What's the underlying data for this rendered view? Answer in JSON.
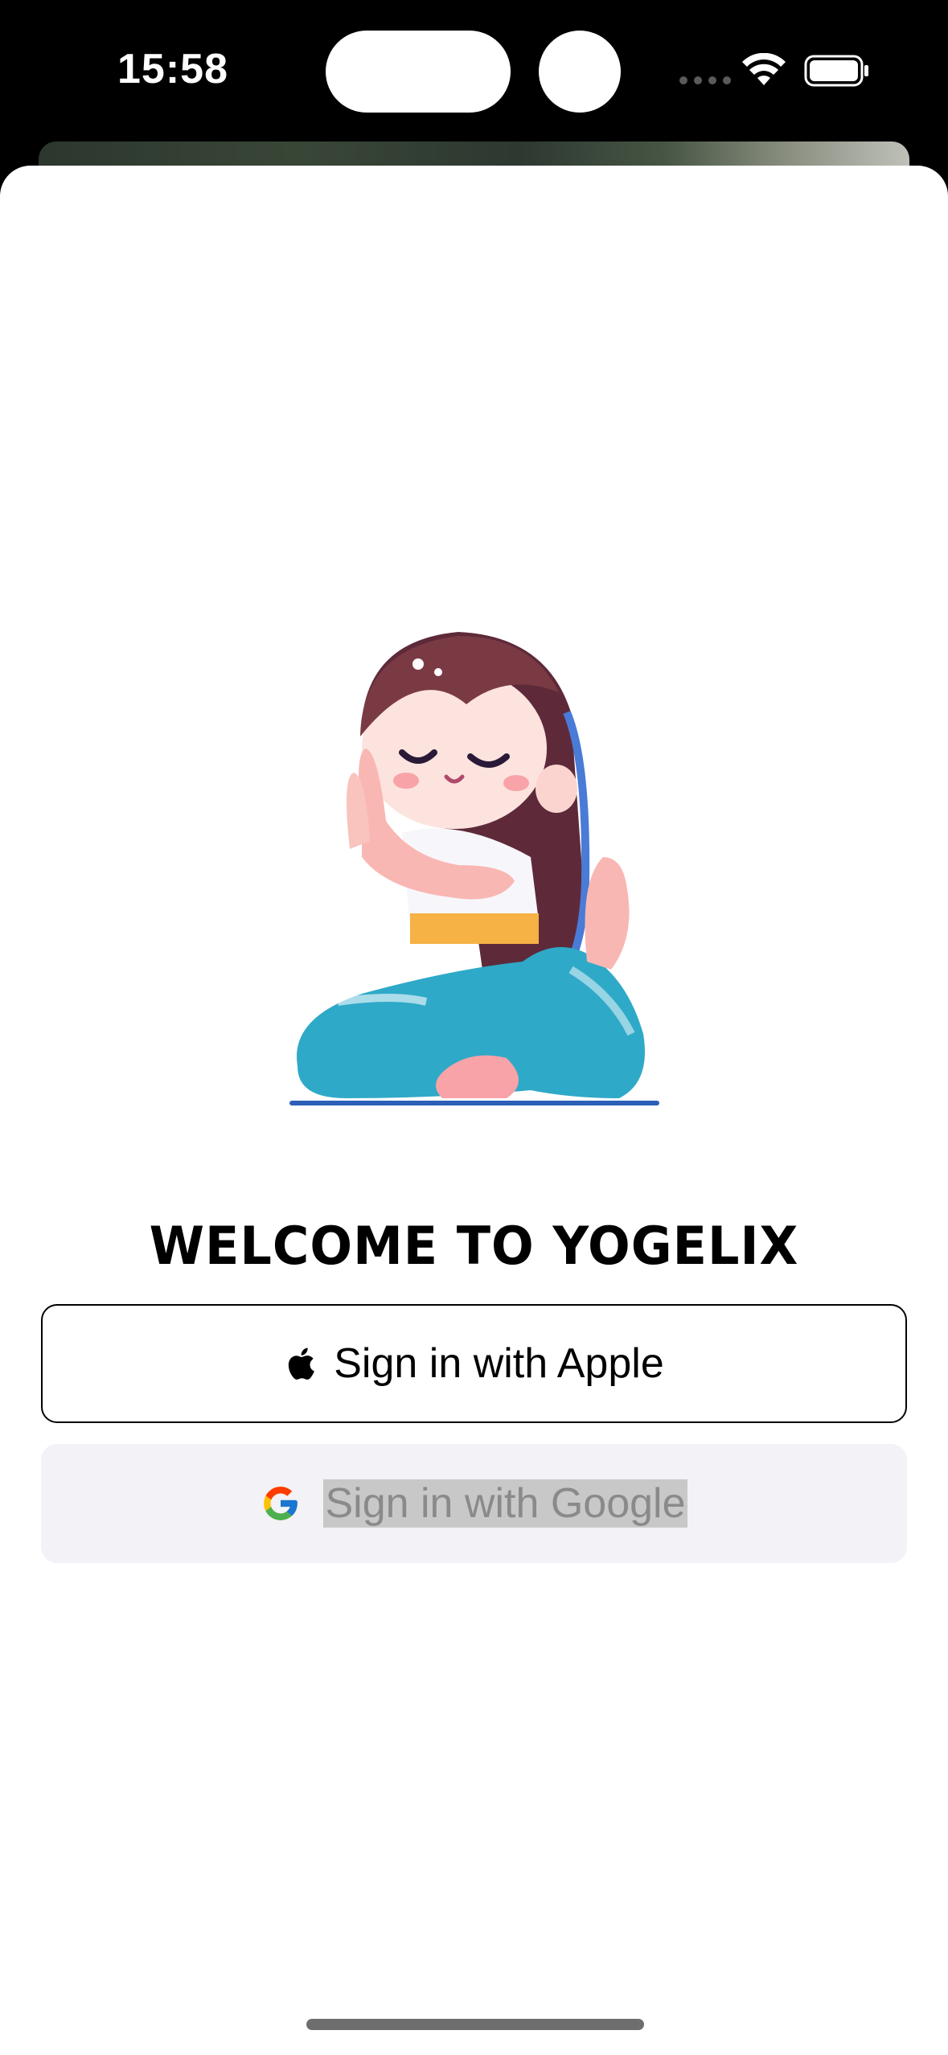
{
  "status_bar": {
    "time": "15:58",
    "icons": [
      "cellular-dots-icon",
      "wifi-icon",
      "battery-icon"
    ]
  },
  "welcome": {
    "title": "WELCOME TO YOGELIX"
  },
  "illustration": {
    "icon": "yoga-girl-illustration"
  },
  "auth": {
    "apple_label": "Sign in with Apple",
    "google_label": "Sign in with Google"
  },
  "colors": {
    "sheet_background": "#ffffff",
    "google_button_background": "#f2f2f7",
    "google_text": "#8e8e93",
    "apple_border": "#000000"
  }
}
